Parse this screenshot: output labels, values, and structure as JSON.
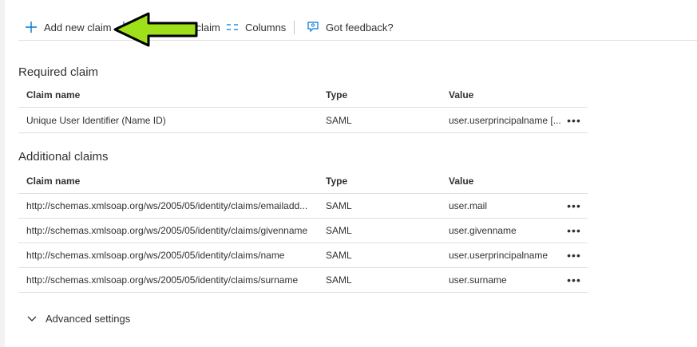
{
  "toolbar": {
    "add_new_claim": "Add new claim",
    "add_group_claim": "Add a group claim",
    "columns": "Columns",
    "got_feedback": "Got feedback?"
  },
  "required": {
    "title": "Required claim",
    "headers": {
      "name": "Claim name",
      "type": "Type",
      "value": "Value"
    },
    "rows": [
      {
        "name": "Unique User Identifier (Name ID)",
        "type": "SAML",
        "value": "user.userprincipalname [...",
        "more": "•••"
      }
    ]
  },
  "additional": {
    "title": "Additional claims",
    "headers": {
      "name": "Claim name",
      "type": "Type",
      "value": "Value"
    },
    "rows": [
      {
        "name": "http://schemas.xmlsoap.org/ws/2005/05/identity/claims/emailadd...",
        "type": "SAML",
        "value": "user.mail",
        "more": "•••"
      },
      {
        "name": "http://schemas.xmlsoap.org/ws/2005/05/identity/claims/givenname",
        "type": "SAML",
        "value": "user.givenname",
        "more": "•••"
      },
      {
        "name": "http://schemas.xmlsoap.org/ws/2005/05/identity/claims/name",
        "type": "SAML",
        "value": "user.userprincipalname",
        "more": "•••"
      },
      {
        "name": "http://schemas.xmlsoap.org/ws/2005/05/identity/claims/surname",
        "type": "SAML",
        "value": "user.surname",
        "more": "•••"
      }
    ]
  },
  "advanced": {
    "label": "Advanced settings"
  },
  "colors": {
    "accent": "#0078d4",
    "arrow_fill": "#9ee01a",
    "arrow_stroke": "#000000"
  }
}
